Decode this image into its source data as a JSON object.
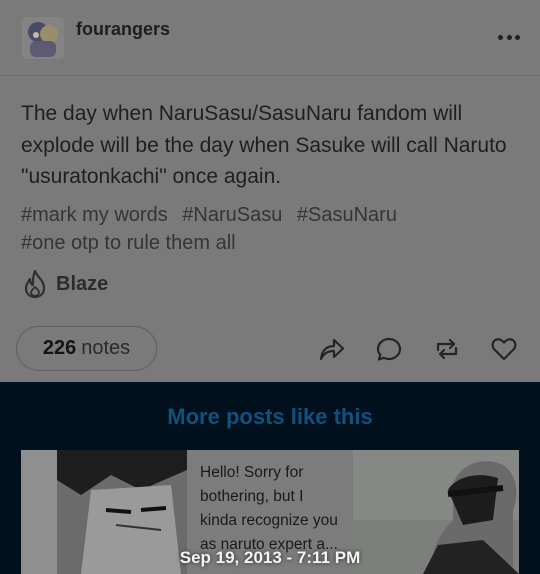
{
  "post": {
    "username": "fourangers",
    "body": "The day when NaruSasu/SasuNaru fandom will explode will be the day when Sasuke will call Naruto \"usuratonkachi\" once again.",
    "tags": [
      "#mark my words",
      "#NaruSasu",
      "#SasuNaru",
      "#one otp to rule them all"
    ],
    "blaze_label": "Blaze",
    "notes_count": "226",
    "notes_label": "notes"
  },
  "icons": {
    "more": "more-horizontal-icon",
    "blaze": "flame-icon",
    "share": "share-icon",
    "reply": "reply-bubble-icon",
    "reblog": "reblog-icon",
    "like": "heart-icon"
  },
  "more_posts": {
    "title": "More posts like this",
    "thumb2_text": "Hello! Sorry for bothering, but I kinda recognize you as naruto expert a..."
  },
  "timestamp": "Sep 19, 2013 - 7:11 PM",
  "colors": {
    "card_bg": "#7a7a7a",
    "section_bg": "#00101d",
    "accent": "#11517e"
  }
}
